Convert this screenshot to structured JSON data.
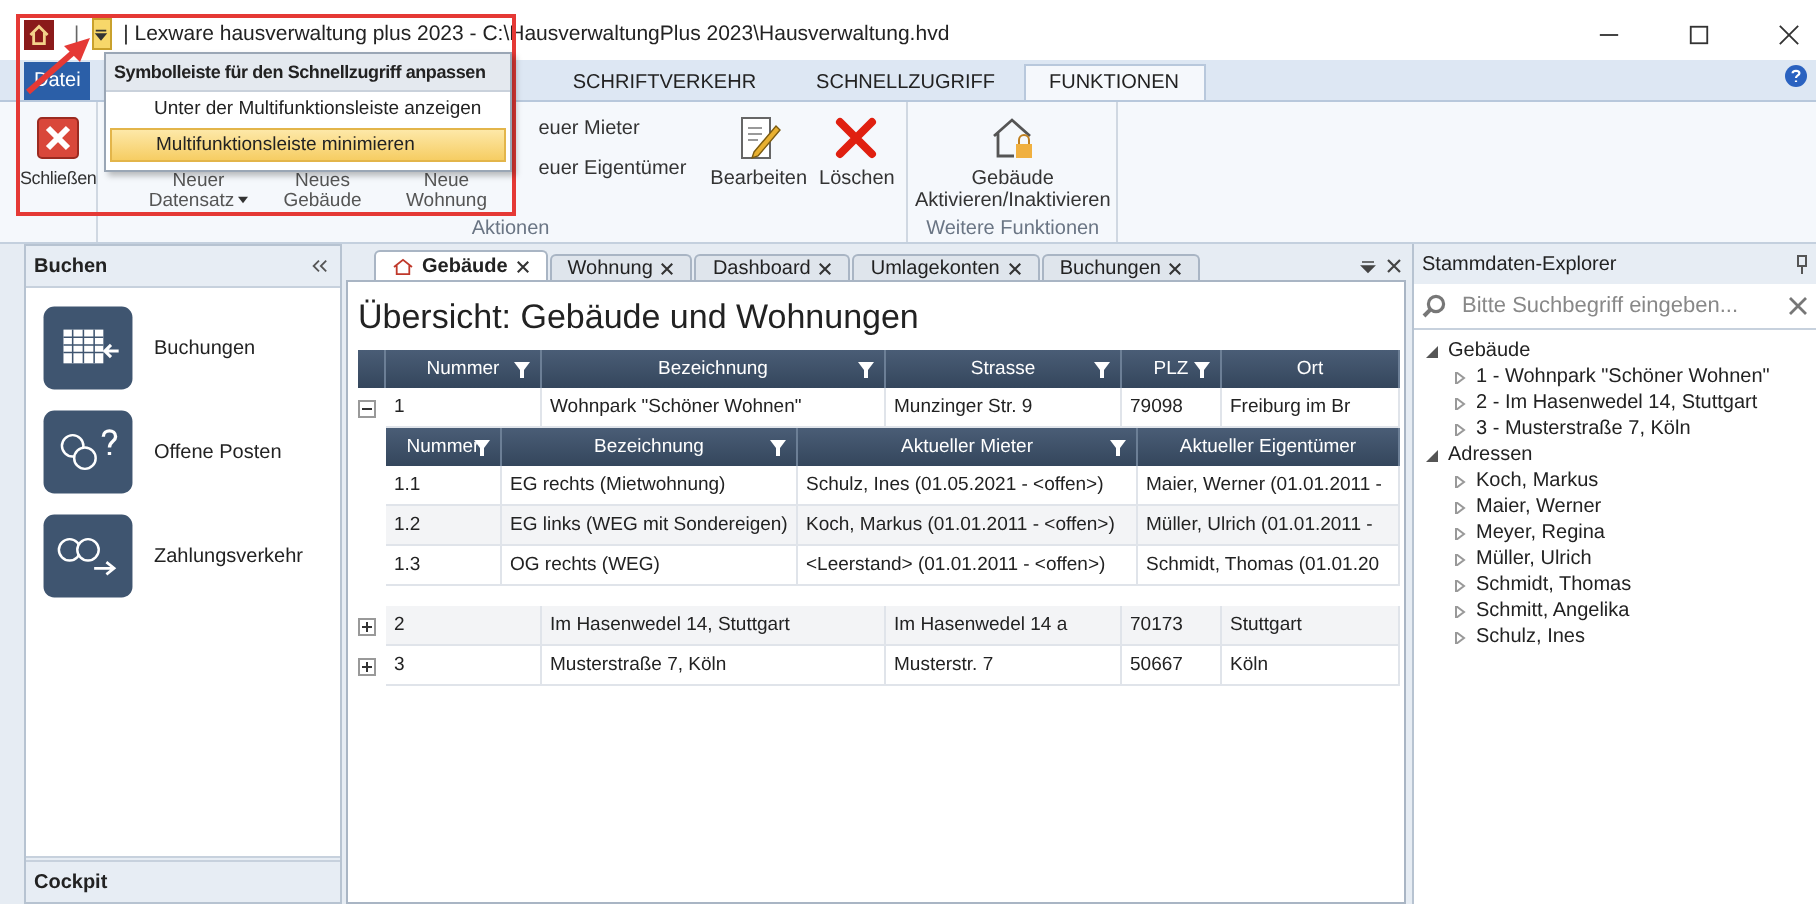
{
  "title_bar": {
    "separator": "|",
    "title": "| Lexware hausverwaltung plus 2023 - C:\\HausverwaltungPlus 2023\\Hausverwaltung.hvd",
    "qat_menu_open": true
  },
  "ribbon_tabs": [
    {
      "label": "Datei",
      "kind": "file"
    },
    {
      "label": "SCHRIFTVERKEHR",
      "kind": "tab",
      "selected": false
    },
    {
      "label": "SCHNELLZUGRIFF",
      "kind": "tab",
      "selected": false
    },
    {
      "label": "FUNKTIONEN",
      "kind": "tab",
      "selected": true
    }
  ],
  "quick_access_menu": {
    "title": "Symbolleiste für den Schnellzugriff anpassen",
    "items": [
      {
        "label": "Unter der Multifunktionsleiste anzeigen",
        "selected": false
      },
      {
        "label": "Multifunktionsleiste minimieren",
        "selected": true
      }
    ]
  },
  "ribbon": {
    "close_button": "Schließen",
    "new_buttons": [
      {
        "label": "Neuer Datensatz",
        "dropdown": true
      },
      {
        "label": "Neues Gebäude",
        "dropdown": false
      },
      {
        "label": "Neue Wohnung",
        "dropdown": false
      }
    ],
    "small_buttons": [
      "euer Mieter",
      "euer Eigentümer"
    ],
    "edit_buttons": [
      {
        "kind": "edit",
        "label": "Bearbeiten"
      },
      {
        "kind": "delete",
        "label": "Löschen"
      }
    ],
    "actions_label": "Aktionen",
    "more_button": "Gebäude Aktivieren/Inaktivieren",
    "more_label": "Weitere Funktionen"
  },
  "left_panel": {
    "title": "Buchen",
    "items": [
      {
        "kind": "bookings",
        "label": "Buchungen"
      },
      {
        "kind": "open_items",
        "label": "Offene Posten"
      },
      {
        "kind": "payments",
        "label": "Zahlungsverkehr"
      }
    ],
    "footer": "Cockpit"
  },
  "doc_tabs": [
    {
      "label": "Gebäude",
      "selected": true
    },
    {
      "label": "Wohnung",
      "selected": false
    },
    {
      "label": "Dashboard",
      "selected": false
    },
    {
      "label": "Umlagekonten",
      "selected": false
    },
    {
      "label": "Buchungen",
      "selected": false
    }
  ],
  "heading": "Übersicht: Gebäude und Wohnungen",
  "grid": {
    "columns": [
      "Nummer",
      "Bezeichnung",
      "Strasse",
      "PLZ",
      "Ort"
    ],
    "rows": [
      {
        "cells": [
          "1",
          "Wohnpark \"Schöner Wohnen\"",
          "Munzinger Str. 9",
          "79098",
          "Freiburg im Br"
        ],
        "expanded": true,
        "detail": {
          "columns": [
            "Nummer",
            "Bezeichnung",
            "Aktueller Mieter",
            "Aktueller Eigentümer"
          ],
          "rows": [
            [
              "1.1",
              "EG rechts (Mietwohnung)",
              "Schulz, Ines (01.05.2021 - <offen>)",
              "Maier, Werner (01.01.2011 -"
            ],
            [
              "1.2",
              "EG links (WEG mit Sondereigen)",
              "Koch, Markus (01.01.2011 - <offen>)",
              "Müller, Ulrich (01.01.2011 -"
            ],
            [
              "1.3",
              "OG rechts (WEG)",
              "<Leerstand> (01.01.2011 - <offen>)",
              "Schmidt, Thomas (01.01.20"
            ]
          ]
        }
      },
      {
        "cells": [
          "2",
          "Im Hasenwedel 14, Stuttgart",
          "Im Hasenwedel 14 a",
          "70173",
          "Stuttgart"
        ],
        "expanded": false
      },
      {
        "cells": [
          "3",
          "Musterstraße 7, Köln",
          "Musterstr. 7",
          "50667",
          "Köln"
        ],
        "expanded": false
      }
    ]
  },
  "explorer": {
    "title": "Stammdaten-Explorer",
    "search": {
      "placeholder": "Bitte Suchbegriff eingeben..."
    },
    "tree": [
      {
        "label": "Gebäude",
        "expanded": true,
        "children": [
          {
            "label": "1 - Wohnpark \"Schöner Wohnen\"",
            "expanded": false
          },
          {
            "label": "2 - Im Hasenwedel 14, Stuttgart",
            "expanded": false
          },
          {
            "label": "3 - Musterstraße 7, Köln",
            "expanded": false
          }
        ]
      },
      {
        "label": "Adressen",
        "expanded": true,
        "children": [
          {
            "label": "Koch, Markus",
            "expanded": false
          },
          {
            "label": "Maier, Werner",
            "expanded": false
          },
          {
            "label": "Meyer, Regina",
            "expanded": false
          },
          {
            "label": "Müller, Ulrich",
            "expanded": false
          },
          {
            "label": "Schmidt, Thomas",
            "expanded": false
          },
          {
            "label": "Schmitt, Angelika",
            "expanded": false
          },
          {
            "label": "Schulz, Ines",
            "expanded": false
          }
        ]
      }
    ]
  }
}
